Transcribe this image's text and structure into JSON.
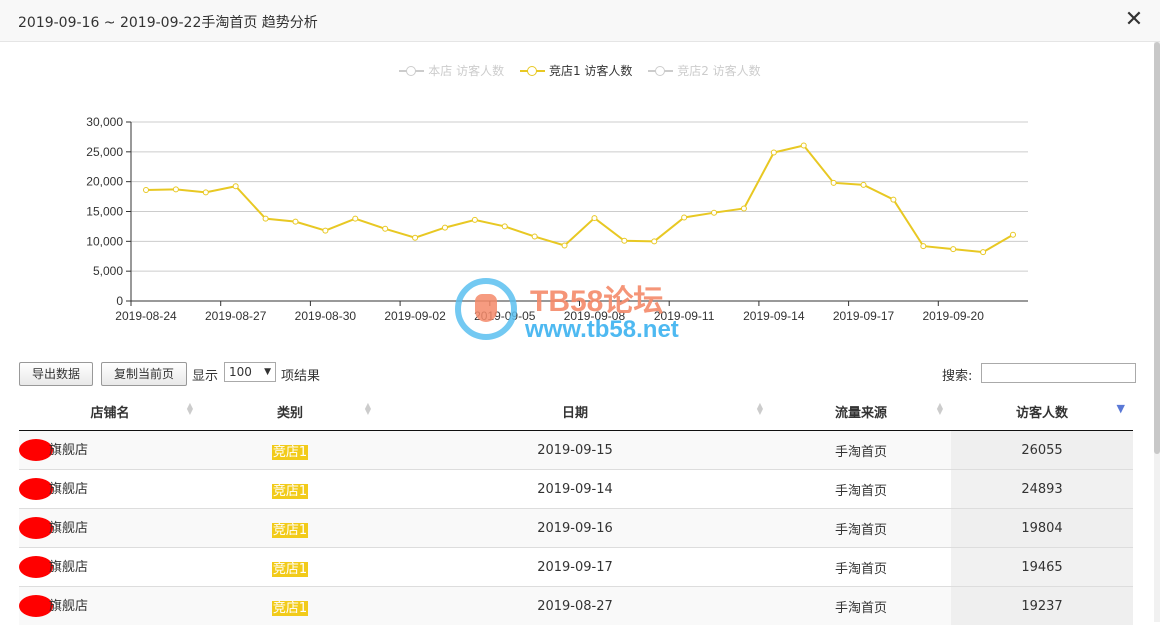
{
  "window": {
    "title": "2019-09-16 ~ 2019-09-22手淘首页 趋势分析",
    "close_glyph": "✕"
  },
  "legend": [
    {
      "name": "本店 访客人数",
      "active": false
    },
    {
      "name": "竞店1 访客人数",
      "active": true
    },
    {
      "name": "竞店2 访客人数",
      "active": false
    }
  ],
  "watermark": {
    "line1": "TB58论坛",
    "line2": "www.tb58.net"
  },
  "chart_data": {
    "type": "line",
    "color": "#e8c823",
    "x": [
      "2019-08-24",
      "2019-08-25",
      "2019-08-26",
      "2019-08-27",
      "2019-08-28",
      "2019-08-29",
      "2019-08-30",
      "2019-08-31",
      "2019-09-01",
      "2019-09-02",
      "2019-09-03",
      "2019-09-04",
      "2019-09-05",
      "2019-09-06",
      "2019-09-07",
      "2019-09-08",
      "2019-09-09",
      "2019-09-10",
      "2019-09-11",
      "2019-09-12",
      "2019-09-13",
      "2019-09-14",
      "2019-09-15",
      "2019-09-16",
      "2019-09-17",
      "2019-09-18",
      "2019-09-19",
      "2019-09-20",
      "2019-09-21",
      "2019-09-22"
    ],
    "x_tick_labels": [
      "2019-08-24",
      "2019-08-27",
      "2019-08-30",
      "2019-09-02",
      "2019-09-05",
      "2019-09-08",
      "2019-09-11",
      "2019-09-14",
      "2019-09-17",
      "2019-09-20"
    ],
    "series": [
      {
        "name": "竞店1 访客人数",
        "values": [
          18600,
          18700,
          18200,
          19237,
          13800,
          13300,
          11800,
          13800,
          12100,
          10600,
          12300,
          13600,
          12500,
          10800,
          9300,
          13900,
          10100,
          10000,
          14000,
          14800,
          15500,
          24893,
          26055,
          19804,
          19465,
          17000,
          9200,
          8700,
          8200,
          11100
        ]
      }
    ],
    "y_ticks": [
      "0",
      "5,000",
      "10,000",
      "15,000",
      "20,000",
      "25,000",
      "30,000"
    ],
    "ylim": [
      0,
      30000
    ],
    "grid": true,
    "legend_position": "top-center"
  },
  "toolbar": {
    "export_label": "导出数据",
    "copy_label": "复制当前页",
    "show_label": "显示",
    "page_size": "100",
    "results_label": "项结果",
    "search_label": "搜索:"
  },
  "table": {
    "headers": [
      "店铺名",
      "类别",
      "日期",
      "流量来源",
      "访客人数"
    ],
    "rows": [
      {
        "shop": "旗舰店",
        "type": "竞店1",
        "date": "2019-09-15",
        "source": "手淘首页",
        "visitors": "26055"
      },
      {
        "shop": "旗舰店",
        "type": "竞店1",
        "date": "2019-09-14",
        "source": "手淘首页",
        "visitors": "24893"
      },
      {
        "shop": "旗舰店",
        "type": "竞店1",
        "date": "2019-09-16",
        "source": "手淘首页",
        "visitors": "19804"
      },
      {
        "shop": "旗舰店",
        "type": "竞店1",
        "date": "2019-09-17",
        "source": "手淘首页",
        "visitors": "19465"
      },
      {
        "shop": "旗舰店",
        "type": "竞店1",
        "date": "2019-08-27",
        "source": "手淘首页",
        "visitors": "19237"
      }
    ]
  }
}
